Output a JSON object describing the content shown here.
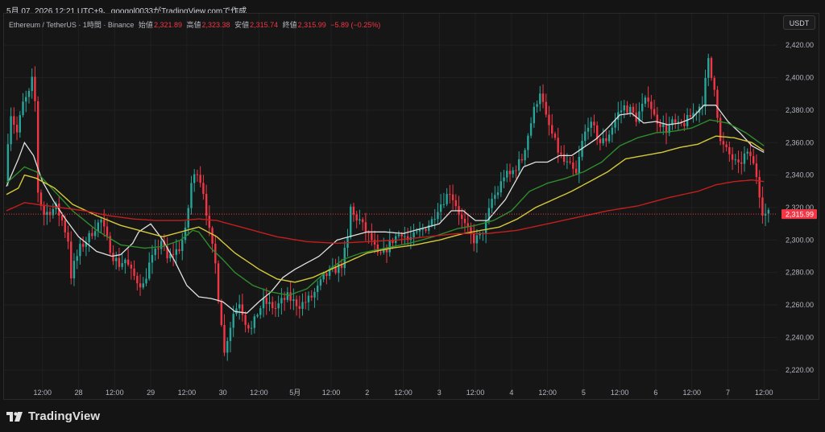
{
  "header": {
    "text": "5月 07, 2026 12:21 UTC+9、googol0033がTradingView.comで作成"
  },
  "legend": {
    "symbol": "Ethereum / TetherUS · 1時間 · Binance",
    "open_label": "始値",
    "open_value": "2,321.89",
    "high_label": "高値",
    "high_value": "2,323.38",
    "low_label": "安値",
    "low_value": "2,315.74",
    "close_label": "終値",
    "close_value": "2,315.99",
    "change": "−5.89 (−0.25%)"
  },
  "currency_button": "USDT",
  "brand": "TradingView",
  "colors": {
    "up": "#26a69a",
    "down": "#f23645",
    "ma_white": "#e0e0e0",
    "ma_green": "#2e8b2e",
    "ma_yellow": "#d4c93a",
    "ma_red": "#c41e1e"
  },
  "chart_data": {
    "type": "line",
    "title": "Ethereum / TetherUS · 1時間 · Binance",
    "ylim": [
      2211,
      2428
    ],
    "y_ticks": [
      2220,
      2240,
      2260,
      2280,
      2300,
      2320,
      2340,
      2360,
      2380,
      2400,
      2420
    ],
    "y_tick_labels": [
      "2,220.00",
      "2,240.00",
      "2,260.00",
      "2,280.00",
      "2,300.00",
      "2,320.00",
      "2,340.00",
      "2,360.00",
      "2,380.00",
      "2,400.00",
      "2,420.00"
    ],
    "x_ticks": [
      {
        "label": "12:00",
        "t": 12
      },
      {
        "label": "28",
        "t": 24
      },
      {
        "label": "12:00",
        "t": 36
      },
      {
        "label": "29",
        "t": 48
      },
      {
        "label": "12:00",
        "t": 60
      },
      {
        "label": "30",
        "t": 72
      },
      {
        "label": "12:00",
        "t": 84
      },
      {
        "label": "5月",
        "t": 96
      },
      {
        "label": "12:00",
        "t": 108
      },
      {
        "label": "2",
        "t": 120
      },
      {
        "label": "12:00",
        "t": 132
      },
      {
        "label": "3",
        "t": 144
      },
      {
        "label": "12:00",
        "t": 156
      },
      {
        "label": "4",
        "t": 168
      },
      {
        "label": "12:00",
        "t": 180
      },
      {
        "label": "5",
        "t": 192
      },
      {
        "label": "12:00",
        "t": 204
      },
      {
        "label": "6",
        "t": 216
      },
      {
        "label": "12:00",
        "t": 228
      },
      {
        "label": "7",
        "t": 240
      },
      {
        "label": "12:00",
        "t": 252
      }
    ],
    "last_price": 2315.99,
    "last_price_label": "2,315.99",
    "price_anchors": [
      [
        0,
        2336
      ],
      [
        1,
        2362
      ],
      [
        2,
        2378
      ],
      [
        4,
        2366
      ],
      [
        6,
        2384
      ],
      [
        8,
        2390
      ],
      [
        9,
        2398
      ],
      [
        10,
        2385
      ],
      [
        11,
        2330
      ],
      [
        12,
        2322
      ],
      [
        13,
        2316
      ],
      [
        15,
        2318
      ],
      [
        17,
        2320
      ],
      [
        19,
        2312
      ],
      [
        21,
        2300
      ],
      [
        22,
        2278
      ],
      [
        23,
        2285
      ],
      [
        24,
        2290
      ],
      [
        25,
        2295
      ],
      [
        28,
        2302
      ],
      [
        30,
        2308
      ],
      [
        32,
        2312
      ],
      [
        34,
        2300
      ],
      [
        36,
        2290
      ],
      [
        38,
        2285
      ],
      [
        40,
        2288
      ],
      [
        42,
        2280
      ],
      [
        44,
        2275
      ],
      [
        46,
        2272
      ],
      [
        48,
        2285
      ],
      [
        50,
        2292
      ],
      [
        52,
        2300
      ],
      [
        54,
        2288
      ],
      [
        56,
        2292
      ],
      [
        58,
        2295
      ],
      [
        60,
        2305
      ],
      [
        62,
        2335
      ],
      [
        64,
        2343
      ],
      [
        65,
        2337
      ],
      [
        66,
        2330
      ],
      [
        68,
        2305
      ],
      [
        70,
        2285
      ],
      [
        71,
        2265
      ],
      [
        72,
        2250
      ],
      [
        73,
        2230
      ],
      [
        74,
        2240
      ],
      [
        76,
        2255
      ],
      [
        78,
        2262
      ],
      [
        80,
        2250
      ],
      [
        82,
        2245
      ],
      [
        84,
        2255
      ],
      [
        86,
        2262
      ],
      [
        88,
        2260
      ],
      [
        90,
        2258
      ],
      [
        92,
        2262
      ],
      [
        94,
        2265
      ],
      [
        96,
        2262
      ],
      [
        98,
        2260
      ],
      [
        100,
        2262
      ],
      [
        102,
        2265
      ],
      [
        104,
        2270
      ],
      [
        106,
        2277
      ],
      [
        108,
        2280
      ],
      [
        110,
        2282
      ],
      [
        112,
        2285
      ],
      [
        114,
        2300
      ],
      [
        115,
        2320
      ],
      [
        116,
        2315
      ],
      [
        118,
        2312
      ],
      [
        120,
        2305
      ],
      [
        122,
        2300
      ],
      [
        124,
        2290
      ],
      [
        126,
        2292
      ],
      [
        128,
        2298
      ],
      [
        130,
        2302
      ],
      [
        132,
        2305
      ],
      [
        134,
        2300
      ],
      [
        136,
        2302
      ],
      [
        138,
        2305
      ],
      [
        140,
        2308
      ],
      [
        142,
        2312
      ],
      [
        144,
        2320
      ],
      [
        146,
        2325
      ],
      [
        148,
        2330
      ],
      [
        150,
        2322
      ],
      [
        152,
        2312
      ],
      [
        154,
        2305
      ],
      [
        156,
        2300
      ],
      [
        158,
        2302
      ],
      [
        160,
        2310
      ],
      [
        162,
        2325
      ],
      [
        164,
        2330
      ],
      [
        166,
        2340
      ],
      [
        168,
        2340
      ],
      [
        170,
        2345
      ],
      [
        172,
        2350
      ],
      [
        174,
        2365
      ],
      [
        176,
        2380
      ],
      [
        178,
        2392
      ],
      [
        180,
        2375
      ],
      [
        182,
        2365
      ],
      [
        184,
        2355
      ],
      [
        186,
        2348
      ],
      [
        188,
        2345
      ],
      [
        190,
        2340
      ],
      [
        192,
        2360
      ],
      [
        194,
        2372
      ],
      [
        196,
        2368
      ],
      [
        198,
        2360
      ],
      [
        200,
        2362
      ],
      [
        202,
        2370
      ],
      [
        204,
        2378
      ],
      [
        206,
        2382
      ],
      [
        208,
        2380
      ],
      [
        210,
        2375
      ],
      [
        212,
        2382
      ],
      [
        214,
        2388
      ],
      [
        216,
        2376
      ],
      [
        218,
        2372
      ],
      [
        220,
        2368
      ],
      [
        222,
        2372
      ],
      [
        224,
        2370
      ],
      [
        226,
        2372
      ],
      [
        228,
        2376
      ],
      [
        230,
        2380
      ],
      [
        232,
        2385
      ],
      [
        234,
        2410
      ],
      [
        235,
        2400
      ],
      [
        236,
        2395
      ],
      [
        238,
        2360
      ],
      [
        240,
        2355
      ],
      [
        242,
        2350
      ],
      [
        244,
        2345
      ],
      [
        246,
        2352
      ],
      [
        248,
        2352
      ],
      [
        250,
        2340
      ],
      [
        252,
        2318
      ],
      [
        253,
        2316
      ]
    ],
    "series": [
      {
        "color": "#e0e0e0",
        "anchors": [
          [
            0,
            2333
          ],
          [
            4,
            2350
          ],
          [
            6,
            2360
          ],
          [
            9,
            2352
          ],
          [
            12,
            2336
          ],
          [
            16,
            2323
          ],
          [
            20,
            2312
          ],
          [
            24,
            2302
          ],
          [
            30,
            2293
          ],
          [
            35,
            2290
          ],
          [
            38,
            2291
          ],
          [
            42,
            2298
          ],
          [
            44,
            2305
          ],
          [
            48,
            2310
          ],
          [
            52,
            2300
          ],
          [
            56,
            2287
          ],
          [
            60,
            2272
          ],
          [
            64,
            2265
          ],
          [
            68,
            2264
          ],
          [
            72,
            2262
          ],
          [
            76,
            2256
          ],
          [
            80,
            2255
          ],
          [
            84,
            2262
          ],
          [
            88,
            2268
          ],
          [
            92,
            2277
          ],
          [
            96,
            2282
          ],
          [
            104,
            2290
          ],
          [
            110,
            2300
          ],
          [
            114,
            2302
          ],
          [
            120,
            2305
          ],
          [
            126,
            2305
          ],
          [
            132,
            2304
          ],
          [
            138,
            2307
          ],
          [
            144,
            2310
          ],
          [
            148,
            2318
          ],
          [
            152,
            2318
          ],
          [
            156,
            2312
          ],
          [
            160,
            2312
          ],
          [
            166,
            2325
          ],
          [
            172,
            2345
          ],
          [
            176,
            2348
          ],
          [
            180,
            2348
          ],
          [
            184,
            2352
          ],
          [
            188,
            2352
          ],
          [
            192,
            2357
          ],
          [
            196,
            2362
          ],
          [
            200,
            2369
          ],
          [
            204,
            2377
          ],
          [
            208,
            2378
          ],
          [
            212,
            2372
          ],
          [
            216,
            2373
          ],
          [
            220,
            2371
          ],
          [
            224,
            2372
          ],
          [
            228,
            2375
          ],
          [
            232,
            2383
          ],
          [
            236,
            2383
          ],
          [
            240,
            2373
          ],
          [
            244,
            2366
          ],
          [
            248,
            2358
          ],
          [
            252,
            2354
          ]
        ]
      },
      {
        "color": "#2e8b2e",
        "anchors": [
          [
            0,
            2335
          ],
          [
            6,
            2345
          ],
          [
            10,
            2342
          ],
          [
            16,
            2330
          ],
          [
            22,
            2318
          ],
          [
            30,
            2306
          ],
          [
            38,
            2297
          ],
          [
            46,
            2295
          ],
          [
            52,
            2296
          ],
          [
            58,
            2300
          ],
          [
            62,
            2306
          ],
          [
            64,
            2305
          ],
          [
            68,
            2295
          ],
          [
            72,
            2288
          ],
          [
            76,
            2280
          ],
          [
            82,
            2272
          ],
          [
            88,
            2268
          ],
          [
            94,
            2266
          ],
          [
            100,
            2270
          ],
          [
            106,
            2280
          ],
          [
            112,
            2288
          ],
          [
            118,
            2292
          ],
          [
            126,
            2295
          ],
          [
            134,
            2298
          ],
          [
            142,
            2302
          ],
          [
            150,
            2307
          ],
          [
            156,
            2309
          ],
          [
            162,
            2312
          ],
          [
            168,
            2318
          ],
          [
            174,
            2330
          ],
          [
            180,
            2335
          ],
          [
            186,
            2338
          ],
          [
            192,
            2342
          ],
          [
            198,
            2348
          ],
          [
            204,
            2358
          ],
          [
            210,
            2363
          ],
          [
            216,
            2366
          ],
          [
            222,
            2367
          ],
          [
            228,
            2369
          ],
          [
            234,
            2374
          ],
          [
            240,
            2372
          ],
          [
            246,
            2366
          ],
          [
            252,
            2358
          ]
        ]
      },
      {
        "color": "#d4c93a",
        "anchors": [
          [
            0,
            2328
          ],
          [
            4,
            2332
          ],
          [
            6,
            2340
          ],
          [
            10,
            2338
          ],
          [
            16,
            2332
          ],
          [
            22,
            2322
          ],
          [
            30,
            2315
          ],
          [
            38,
            2309
          ],
          [
            46,
            2305
          ],
          [
            52,
            2302
          ],
          [
            58,
            2305
          ],
          [
            62,
            2307
          ],
          [
            64,
            2308
          ],
          [
            70,
            2302
          ],
          [
            76,
            2292
          ],
          [
            84,
            2282
          ],
          [
            90,
            2276
          ],
          [
            96,
            2274
          ],
          [
            102,
            2277
          ],
          [
            108,
            2282
          ],
          [
            114,
            2287
          ],
          [
            120,
            2292
          ],
          [
            128,
            2295
          ],
          [
            136,
            2297
          ],
          [
            144,
            2300
          ],
          [
            152,
            2304
          ],
          [
            158,
            2306
          ],
          [
            164,
            2308
          ],
          [
            170,
            2313
          ],
          [
            176,
            2320
          ],
          [
            182,
            2325
          ],
          [
            188,
            2330
          ],
          [
            194,
            2336
          ],
          [
            200,
            2342
          ],
          [
            206,
            2350
          ],
          [
            212,
            2352
          ],
          [
            218,
            2354
          ],
          [
            224,
            2357
          ],
          [
            230,
            2359
          ],
          [
            236,
            2364
          ],
          [
            242,
            2363
          ],
          [
            248,
            2360
          ],
          [
            252,
            2355
          ]
        ]
      },
      {
        "color": "#c41e1e",
        "anchors": [
          [
            0,
            2318
          ],
          [
            6,
            2323
          ],
          [
            10,
            2322
          ],
          [
            18,
            2320
          ],
          [
            26,
            2318
          ],
          [
            34,
            2315
          ],
          [
            42,
            2313
          ],
          [
            50,
            2312
          ],
          [
            58,
            2312
          ],
          [
            64,
            2313
          ],
          [
            70,
            2312
          ],
          [
            80,
            2307
          ],
          [
            90,
            2302
          ],
          [
            100,
            2299
          ],
          [
            110,
            2298
          ],
          [
            120,
            2299
          ],
          [
            130,
            2300
          ],
          [
            140,
            2302
          ],
          [
            150,
            2304
          ],
          [
            160,
            2304
          ],
          [
            170,
            2306
          ],
          [
            180,
            2310
          ],
          [
            190,
            2314
          ],
          [
            200,
            2318
          ],
          [
            210,
            2321
          ],
          [
            220,
            2326
          ],
          [
            230,
            2330
          ],
          [
            236,
            2334
          ],
          [
            242,
            2336
          ],
          [
            248,
            2337
          ],
          [
            252,
            2336
          ]
        ]
      }
    ]
  }
}
